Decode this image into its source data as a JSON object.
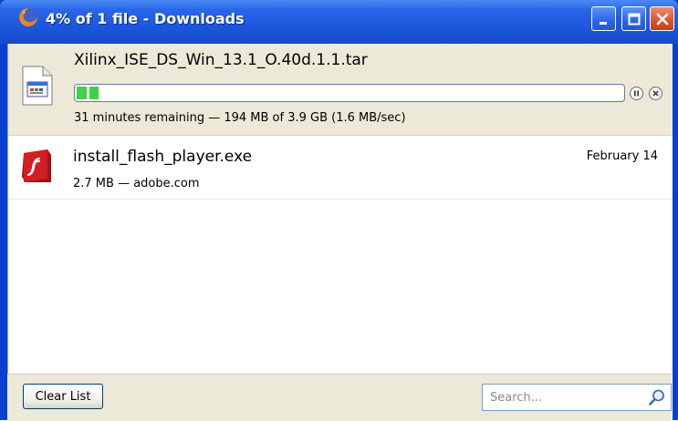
{
  "window": {
    "title": "4% of 1 file - Downloads"
  },
  "downloads": [
    {
      "filename": "Xilinx_ISE_DS_Win_13.1_O.40d.1.1.tar",
      "status": "31 minutes remaining — 194 MB of 3.9 GB (1.6 MB/sec)",
      "progress_percent": 4,
      "icon": "generic-file-icon",
      "state": "downloading"
    },
    {
      "filename": "install_flash_player.exe",
      "status": "2.7 MB — adobe.com",
      "date": "February 14",
      "icon": "flash-icon",
      "state": "complete"
    }
  ],
  "footer": {
    "clear_label": "Clear List",
    "search_placeholder": "Search..."
  },
  "colors": {
    "titlebar": "#1f5ae0",
    "progress": "#3fd14a",
    "selected_row": "#ece9d8"
  }
}
